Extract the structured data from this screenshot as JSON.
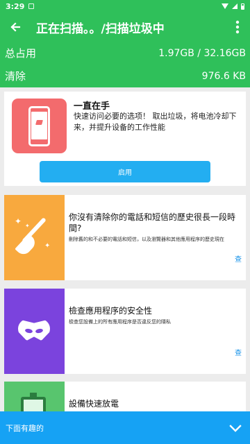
{
  "status_bar": {
    "time": "3:29",
    "icons": [
      "notification-icon",
      "wifi-icon",
      "signal-icon",
      "battery-icon"
    ]
  },
  "header": {
    "title": "正在扫描。。/扫描垃圾中",
    "back_icon": "back-arrow-icon",
    "menu_icon": "more-vertical-icon",
    "stats": [
      {
        "label": "总占用",
        "value": "1.97GB / 32.16GB"
      },
      {
        "label": "清除",
        "value": "976.6 KB"
      }
    ]
  },
  "promo": {
    "title": "一直在手",
    "text": "快速访问必要的选项！ 取出垃圾，将电池冷却下来，并提升设备的工作性能",
    "button_label": "启用",
    "image_color": "#f36b6d",
    "button_color": "#23aef1"
  },
  "features": [
    {
      "title": "你沒有清除你的電話和短信的歷史很長一段時間?",
      "description": "刪除舊的和不必要的電話和短信，以及瀏覽器和其他應用程序的歷史現在",
      "link": "查",
      "icon": "broom-sparkle-icon",
      "image_color": "#f8a93e"
    },
    {
      "title": "檢查應用程序的安全性",
      "description": "檢查您設備上的所有應用程序是否違反您的隱私",
      "link": "查",
      "icon": "mask-icon",
      "image_color": "#7b43dd"
    },
    {
      "title": "設備快速放電",
      "icon": "battery-icon",
      "image_color": "#58c56e"
    }
  ],
  "bottom_bar": {
    "label": "下面有趣的",
    "icon": "chevron-down-icon",
    "color": "#16a2f4"
  },
  "colors": {
    "header": "#2fc05a",
    "link": "#1692e8",
    "background": "#ececec"
  }
}
